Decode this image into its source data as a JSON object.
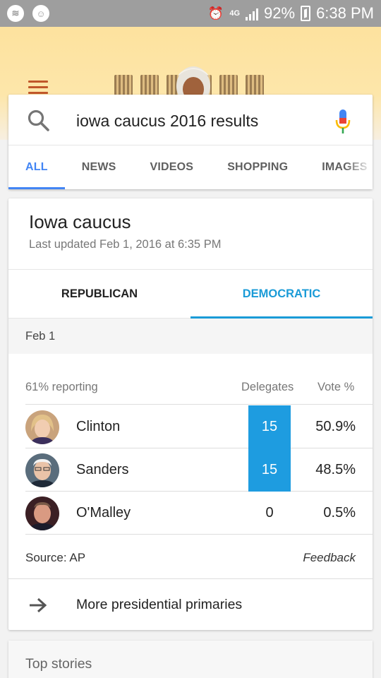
{
  "status_bar": {
    "battery": "92%",
    "time": "6:38 PM",
    "network_label": "4G",
    "icons": [
      "spotify-icon",
      "chat-icon",
      "alarm-icon",
      "data-icon",
      "signal-icon",
      "battery-icon"
    ]
  },
  "search": {
    "query": "iowa caucus 2016 results",
    "tabs": [
      "ALL",
      "NEWS",
      "VIDEOS",
      "SHOPPING",
      "IMAGES"
    ],
    "active_tab": "ALL"
  },
  "result": {
    "title": "Iowa caucus",
    "updated": "Last updated Feb 1, 2016 at 6:35 PM",
    "party_tabs": [
      "REPUBLICAN",
      "DEMOCRATIC"
    ],
    "active_party": "DEMOCRATIC",
    "date": "Feb 1",
    "reporting": "61% reporting",
    "col_delegates": "Delegates",
    "col_vote": "Vote %",
    "candidates": [
      {
        "name": "Clinton",
        "delegates": "15",
        "vote": "50.9%"
      },
      {
        "name": "Sanders",
        "delegates": "15",
        "vote": "48.5%"
      },
      {
        "name": "O'Malley",
        "delegates": "0",
        "vote": "0.5%"
      }
    ],
    "source": "Source: AP",
    "feedback": "Feedback",
    "more": "More presidential primaries"
  },
  "top_stories": "Top stories",
  "colors": {
    "accent_blue": "#4285f4",
    "party_blue": "#1a9bd7",
    "delegate_win": "#1e9ce0",
    "status_bar": "#9e9e9e",
    "doodle_bg": "#fde29e"
  }
}
